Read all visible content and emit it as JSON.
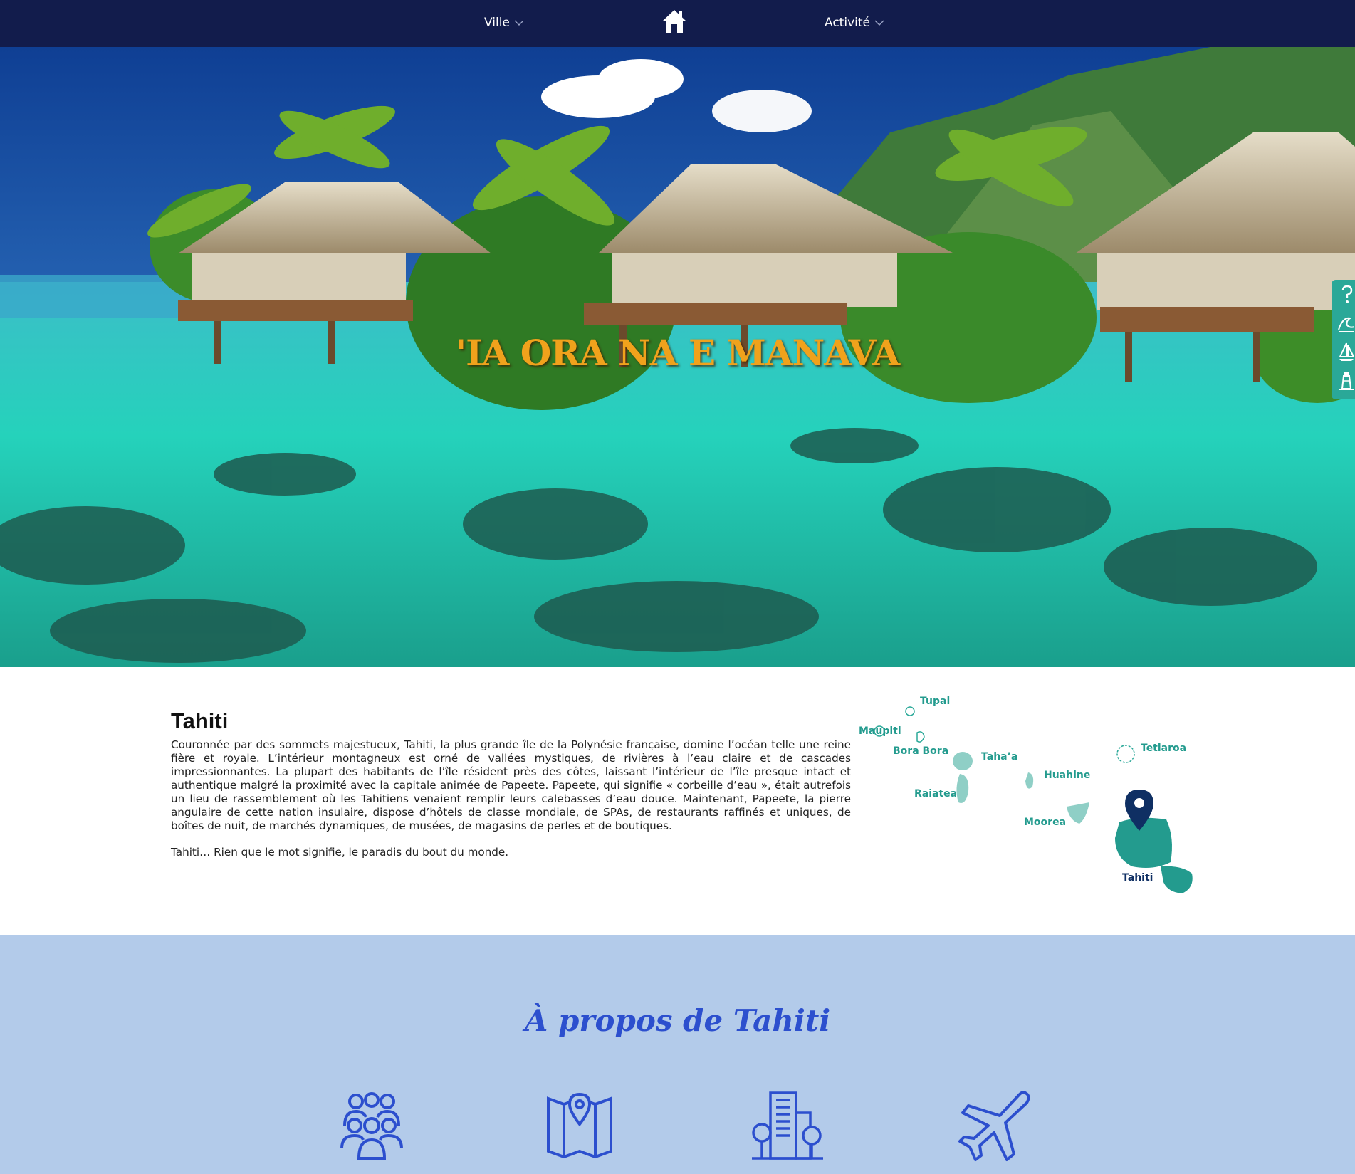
{
  "nav": {
    "left_label": "Ville",
    "right_label": "Activité",
    "home_icon": "home-icon"
  },
  "hero": {
    "title": "'IA ORA NA E MANAVA",
    "side_icons": [
      "question-icon",
      "wave-icon",
      "sailboat-icon",
      "lighthouse-icon"
    ]
  },
  "intro": {
    "title": "Tahiti",
    "paragraph": "Couronnée par des sommets majestueux, Tahiti, la plus grande île de la Polynésie française, domine l’océan telle une reine fière et royale. L’intérieur montagneux est orné de vallées mystiques, de rivières à l’eau claire et de cascades impressionnantes. La plupart des habitants de l’île résident près des côtes, laissant l’intérieur de l’île presque intact et authentique malgré la proximité avec la capitale animée de Papeete. Papeete, qui signifie « corbeille d’eau », était autrefois un lieu de rassemblement où les Tahitiens venaient remplir leurs calebasses d’eau douce. Maintenant, Papeete, la pierre angulaire de cette nation insulaire, dispose d’hôtels de classe mondiale, de SPAs, de restaurants raffinés et uniques, de boîtes de nuit, de marchés dynamiques, de musées, de magasins de perles et de boutiques.",
    "tagline": "Tahiti… Rien que le mot signifie, le paradis du bout du monde."
  },
  "map": {
    "islands": [
      "Tupai",
      "Maupiti",
      "Bora Bora",
      "Taha’a",
      "Tetiaroa",
      "Huahine",
      "Raiatea",
      "Moorea",
      "Tahiti"
    ],
    "selected": "Tahiti",
    "colors": {
      "island": "#2aa898",
      "island_light": "#8fcfc6",
      "pin": "#0f2f63"
    }
  },
  "about": {
    "title": "À propos de Tahiti",
    "icons": [
      "people-icon",
      "map-pin-icon",
      "city-icon",
      "airplane-icon"
    ]
  },
  "colors": {
    "nav_bg": "#121c4c",
    "hero_title": "#f0a21c",
    "about_bg": "#b3cbea",
    "about_accent": "#2c4fce",
    "side_tab": "#2aa898"
  }
}
